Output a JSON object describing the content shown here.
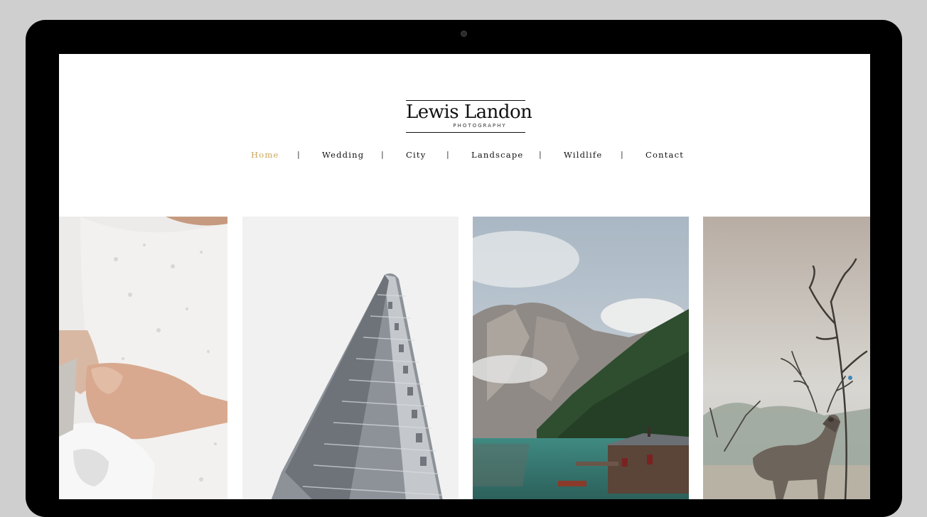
{
  "brand": {
    "name": "Lewis Landon",
    "tagline": "PHOTOGRAPHY"
  },
  "nav": {
    "items": [
      {
        "label": "Home",
        "active": true
      },
      {
        "label": "Wedding",
        "active": false
      },
      {
        "label": "City",
        "active": false
      },
      {
        "label": "Landscape",
        "active": false
      },
      {
        "label": "Wildlife",
        "active": false
      },
      {
        "label": "Contact",
        "active": false
      }
    ],
    "separator": "|",
    "active_color": "#c8a55a"
  },
  "gallery": {
    "tiles": [
      "wedding-photo",
      "city-photo",
      "landscape-photo",
      "wildlife-photo"
    ]
  }
}
